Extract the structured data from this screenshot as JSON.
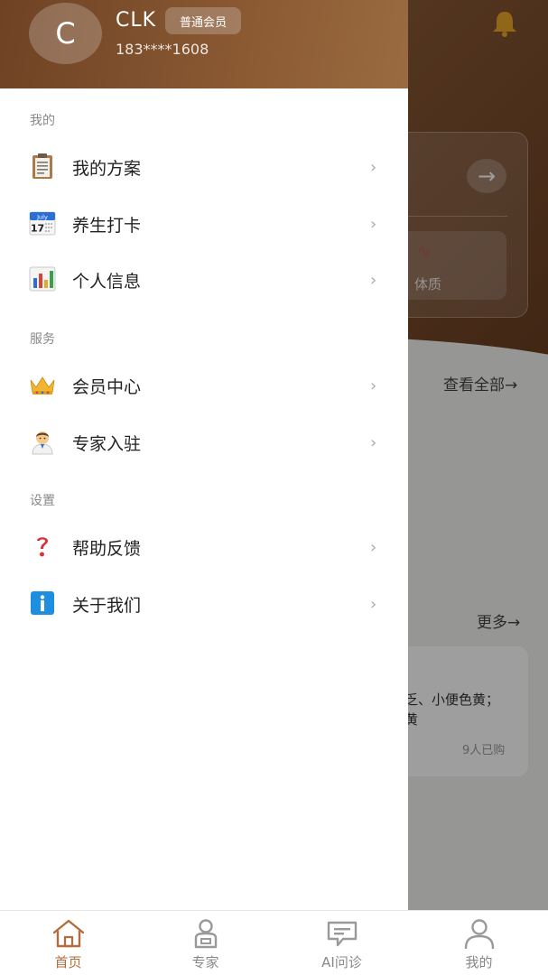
{
  "user": {
    "avatar_letter": "C",
    "name": "CLK",
    "member_level": "普通会员",
    "phone": "183****1608"
  },
  "sections": [
    {
      "title": "我的",
      "items": [
        {
          "label": "我的方案",
          "icon": "clipboard-icon"
        },
        {
          "label": "养生打卡",
          "icon": "calendar-icon"
        },
        {
          "label": "个人信息",
          "icon": "bar-chart-icon"
        }
      ]
    },
    {
      "title": "服务",
      "items": [
        {
          "label": "会员中心",
          "icon": "crown-icon"
        },
        {
          "label": "专家入驻",
          "icon": "doctor-icon"
        }
      ]
    },
    {
      "title": "设置",
      "items": [
        {
          "label": "帮助反馈",
          "icon": "question-icon"
        },
        {
          "label": "关于我们",
          "icon": "info-icon"
        }
      ]
    }
  ],
  "calendar_icon": {
    "month": "July",
    "day": "17"
  },
  "chevron": "›",
  "background": {
    "card_label": "体质",
    "view_all": "查看全部→",
    "more": "更多→",
    "product_text": "乏、小便色黄；",
    "product_text2": "黄",
    "sold": "9人已购"
  },
  "tabbar": {
    "tabs": [
      {
        "label": "首页",
        "icon": "home-icon",
        "active": true
      },
      {
        "label": "专家",
        "icon": "expert-icon",
        "active": false
      },
      {
        "label": "AI问诊",
        "icon": "chat-icon",
        "active": false
      },
      {
        "label": "我的",
        "icon": "user-icon",
        "active": false
      }
    ]
  },
  "colors": {
    "brand_brown": "#8b5a33",
    "active_tab": "#b46c3c",
    "inactive_tab": "#888888"
  }
}
